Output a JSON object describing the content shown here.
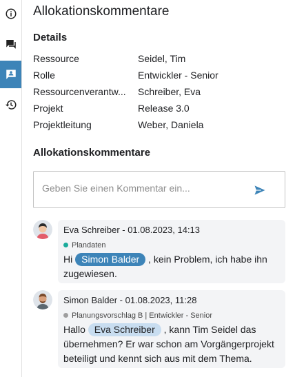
{
  "sidebar": {
    "items": [
      {
        "icon": "info-icon",
        "active": false
      },
      {
        "icon": "chat-icon",
        "active": false
      },
      {
        "icon": "comment-person-icon",
        "active": true
      },
      {
        "icon": "history-icon",
        "active": false
      }
    ]
  },
  "page_title": "Allokationskommentare",
  "details": {
    "heading": "Details",
    "rows": [
      {
        "label": "Ressource",
        "value": "Seidel, Tim"
      },
      {
        "label": "Rolle",
        "value": "Entwickler - Senior"
      },
      {
        "label": "Ressourcenverantw...",
        "value": "Schreiber, Eva"
      },
      {
        "label": "Projekt",
        "value": "Release 3.0"
      },
      {
        "label": "Projektleitung",
        "value": "Weber, Daniela"
      }
    ]
  },
  "comments": {
    "heading": "Allokationskommentare",
    "input": {
      "placeholder": "Geben Sie einen Kommentar ein...",
      "value": ""
    },
    "items": [
      {
        "author_line": "Eva Schreiber - 01.08.2023, 14:13",
        "source": "Plandaten",
        "source_color": "#1aab9b",
        "text_before": "Hi ",
        "mention": "Simon Balder",
        "text_after": " , kein Problem, ich habe ihn zugewiesen."
      },
      {
        "author_line": "Simon Balder - 01.08.2023, 11:28",
        "source": "Planungsvorschlag B | Entwickler - Senior",
        "source_color": "#9e9e9e",
        "text_before": "Hallo ",
        "mention": "Eva Schreiber",
        "text_after": " , kann Tim Seidel das übernehmen? Er war schon am Vorgängerprojekt beteiligt und kennt sich aus mit dem Thema."
      }
    ]
  },
  "colors": {
    "accent": "#3d84b8",
    "mention_light": "#c8ddf0",
    "bubble": "#f3f4f6"
  }
}
